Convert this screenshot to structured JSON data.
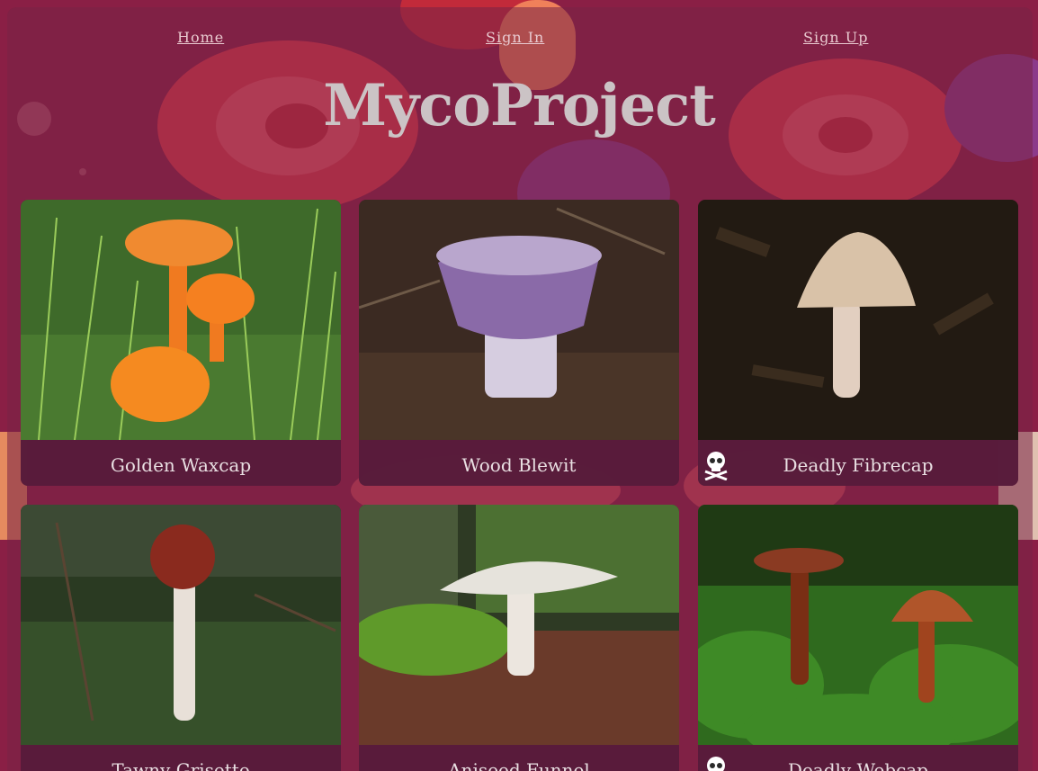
{
  "nav": {
    "home": "Home",
    "sign_in": "Sign In",
    "sign_up": "Sign Up"
  },
  "site_title": "MycoProject",
  "cards": [
    {
      "name": "Golden Waxcap",
      "toxic": false
    },
    {
      "name": "Wood Blewit",
      "toxic": false
    },
    {
      "name": "Deadly Fibrecap",
      "toxic": true
    },
    {
      "name": "Tawny Grisette",
      "toxic": false
    },
    {
      "name": "Aniseed Funnel",
      "toxic": false
    },
    {
      "name": "Deadly Webcap",
      "toxic": true
    }
  ],
  "colors": {
    "background": "#8a1f45",
    "title": "#cbc3c5",
    "nav_link": "#e8c9cf",
    "caption_text": "#e9dfe2"
  },
  "icons": {
    "toxic": "skull-crossbones-icon"
  }
}
